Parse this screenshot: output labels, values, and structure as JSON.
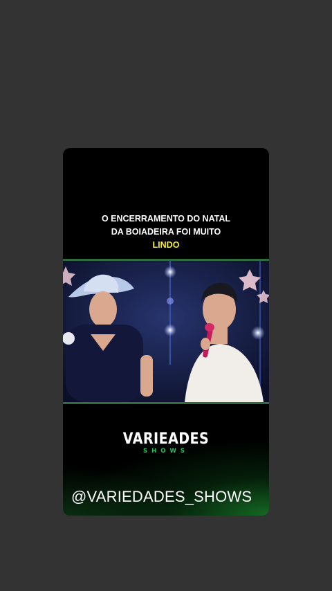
{
  "caption": {
    "line1": "O ENCERRAMENTO DO NATAL",
    "line2": "DA BOIADEIRA FOI MUITO",
    "highlight": "LINDO",
    "text_color": "#ffffff",
    "highlight_color": "#f5ee2a"
  },
  "brand": {
    "main": "VARIEADES",
    "sub": "SHOWS",
    "sub_color": "#22c25a"
  },
  "handle": "@VARIEDADES_SHOWS",
  "colors": {
    "page_background": "#333333",
    "card_background": "#000000",
    "glow": "#1c8c30"
  }
}
